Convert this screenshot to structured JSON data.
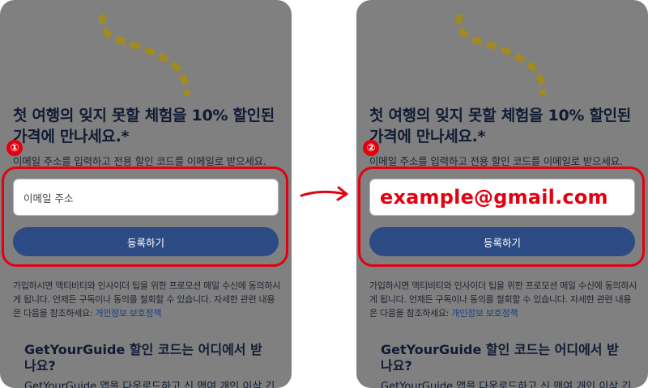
{
  "panels": [
    {
      "step": "①",
      "headline": "첫 여행의 잊지 못할 체험을 10% 할인된 가격에 만나세요.*",
      "subtext": "이메일 주소를 입력하고 전용 할인 코드를 이메일로 받으세요.",
      "email_placeholder": "이메일 주소",
      "email_value": "",
      "register_label": "등록하기",
      "legal_text": "가입하시면 액티비티와 인사이더 팁을 위한 프로모션 메일 수신에 동의하시게 됩니다. 언제든 구독이나 동의를 철회할 수 있습니다. 자세한 관련 내용은 다음을 참조하세요: ",
      "privacy_link": "개인정보 보호정책",
      "faq_heading": "GetYourGuide 할인 코드는 어디에서 받나요?",
      "faq_text": "GetYourGuide 앱을 다운로드하고 신 맨여 개인 이삭 긴"
    },
    {
      "step": "②",
      "headline": "첫 여행의 잊지 못할 체험을 10% 할인된 가격에 만나세요.*",
      "subtext": "이메일 주소를 입력하고 전용 할인 코드를 이메일로 받으세요.",
      "email_placeholder": "",
      "email_value": "example@gmail.com",
      "register_label": "등록하기",
      "legal_text": "가입하시면 액티비티와 인사이더 팁을 위한 프로모션 메일 수신에 동의하시게 됩니다. 언제든 구독이나 동의를 철회할 수 있습니다. 자세한 관련 내용은 다음을 참조하세요: ",
      "privacy_link": "개인정보 보호정책",
      "faq_heading": "GetYourGuide 할인 코드는 어디에서 받나요?",
      "faq_text": "GetYourGuide 앱을 다운로드하고 신 맨여 개인 이삭 긴"
    }
  ],
  "colors": {
    "annotation_red": "#e3000f",
    "button_blue": "#2c4a84",
    "dim_overlay": "#808080",
    "deco_gold": "#a08a21"
  },
  "icons": {
    "arrow": "curved-arrow-right-icon",
    "decoration": "dashed-squiggle-decoration"
  }
}
